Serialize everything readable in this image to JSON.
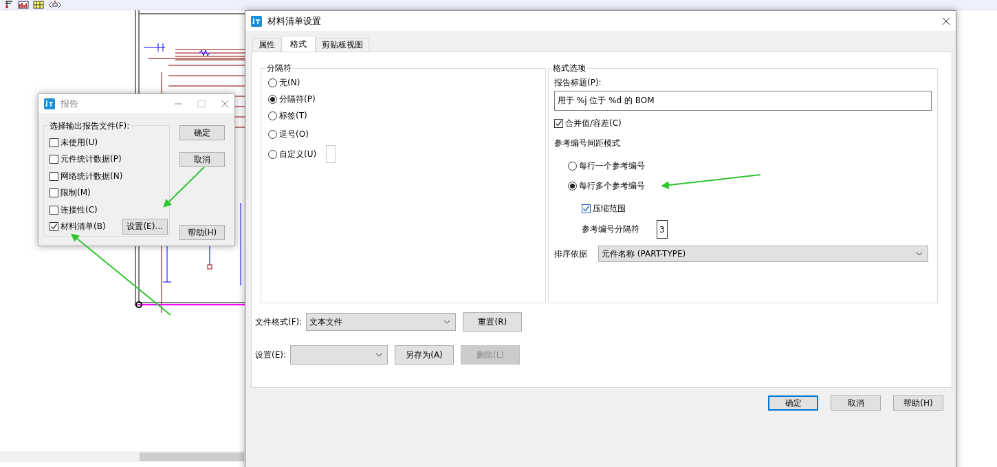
{
  "report_dialog": {
    "title": "报告",
    "group_label": "选择输出报告文件(F):",
    "options": [
      {
        "label": "未使用(U)",
        "checked": false
      },
      {
        "label": "元件统计数据(P)",
        "checked": false
      },
      {
        "label": "网络统计数据(N)",
        "checked": false
      },
      {
        "label": "限制(M)",
        "checked": false
      },
      {
        "label": "连接性(C)",
        "checked": false
      },
      {
        "label": "材料清单(B)",
        "checked": true
      }
    ],
    "settings_button": "设置(E)...",
    "buttons": [
      "确定",
      "取消",
      "帮助(H)"
    ]
  },
  "bom_dialog": {
    "title": "材料清单设置",
    "tabs": [
      {
        "label": "属性",
        "selected": false
      },
      {
        "label": "格式",
        "selected": true
      },
      {
        "label": "剪贴板视图",
        "selected": false
      }
    ],
    "separator_group": {
      "label": "分隔符",
      "options": [
        {
          "label": "无(N)",
          "selected": false
        },
        {
          "label": "分隔符(P)",
          "selected": true
        },
        {
          "label": "标签(T)",
          "selected": false
        },
        {
          "label": "逗号(O)",
          "selected": false
        },
        {
          "label": "自定义(U)",
          "selected": false,
          "kind": "custom"
        }
      ]
    },
    "format_options": {
      "label": "格式选项",
      "report_title_label": "报告标题(P):",
      "report_title": "用于 %j 位于 %d 的 BOM",
      "combine": {
        "label": "合并值/容差(C)",
        "checked": true
      },
      "spacing_label": "参考编号间距模式",
      "spacing_options": [
        {
          "label": "每行一个参考编号",
          "selected": false
        },
        {
          "label": "每行多个参考编号",
          "selected": true
        }
      ],
      "compress": {
        "label": "压缩范围",
        "checked": true
      },
      "ref_sep_label": "参考编号分隔符",
      "ref_sep_value": "3",
      "sort_label": "排序依据",
      "sort_value": "元件名称 (PART-TYPE)"
    },
    "file_format": {
      "label": "文件格式(F):",
      "value": "文本文件"
    },
    "reset_button": "重置(R)",
    "setting_label": "设置(E):",
    "save_as_button": "另存为(A)",
    "delete_button": {
      "label": "删除(L)",
      "disabled": true
    },
    "buttons": [
      {
        "label": "确定",
        "default": true
      },
      {
        "label": "取消",
        "default": false
      },
      {
        "label": "帮助(H)",
        "default": false
      }
    ]
  }
}
